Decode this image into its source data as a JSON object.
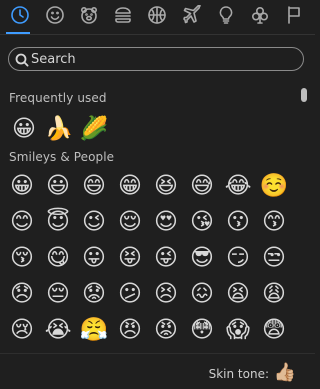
{
  "tabs": [
    {
      "name": "recent",
      "icon": "clock-icon",
      "active": true
    },
    {
      "name": "smileys",
      "icon": "smiley-icon"
    },
    {
      "name": "animals",
      "icon": "bear-icon"
    },
    {
      "name": "food",
      "icon": "burger-icon"
    },
    {
      "name": "activities",
      "icon": "ball-icon"
    },
    {
      "name": "travel",
      "icon": "airplane-icon"
    },
    {
      "name": "objects",
      "icon": "lightbulb-icon"
    },
    {
      "name": "symbols",
      "icon": "club-icon"
    },
    {
      "name": "flags",
      "icon": "flag-icon"
    }
  ],
  "search": {
    "placeholder": "Search",
    "value": ""
  },
  "sections": {
    "frequent": {
      "title": "Frequently used",
      "items": [
        "😀",
        "🍌",
        "🌽"
      ]
    },
    "smileys": {
      "title": "Smileys & People",
      "rows": [
        [
          "😀",
          "😃",
          "😄",
          "😁",
          "😆",
          "😅",
          "😂",
          "☺️"
        ],
        [
          "😊",
          "😇",
          "😉",
          "😌",
          "😍",
          "😘",
          "😗",
          "😙"
        ],
        [
          "😚",
          "😋",
          "😛",
          "😝",
          "😜",
          "😎",
          "😏",
          "😒"
        ],
        [
          "😞",
          "😔",
          "😟",
          "😕",
          "😣",
          "😖",
          "😫",
          "😩"
        ],
        [
          "😢",
          "😭",
          "😤",
          "😠",
          "😡",
          "😳",
          "😱",
          "😨"
        ]
      ]
    }
  },
  "footer": {
    "skin_label": "Skin tone:",
    "skin_emoji": "👍🏼"
  },
  "colors": {
    "accent": "#3f9cff",
    "background": "#1f1f1f"
  }
}
